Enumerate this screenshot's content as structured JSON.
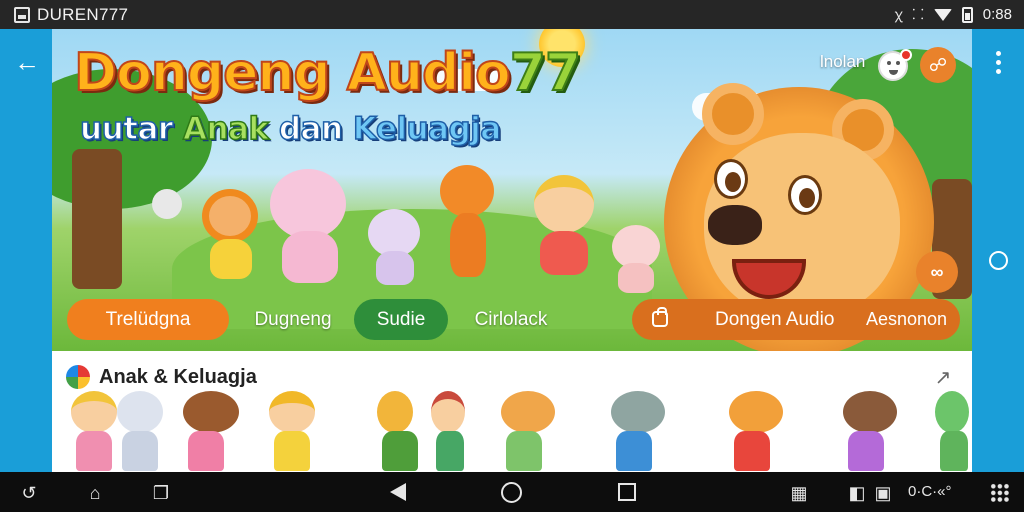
{
  "statusbar": {
    "app_name": "DUREN777",
    "right_glyph_1": "ꭓ",
    "right_glyph_2": "⸬",
    "clock": "0:88"
  },
  "hero": {
    "title_main": "Dongeng Audio",
    "title_accent": "77",
    "subtitle_prefix": "uutar ",
    "subtitle_green": "Anak",
    "subtitle_mid": " dan ",
    "subtitle_blue": "Keluagja",
    "login_label": "lnolan",
    "lock_icon": "lock-icon",
    "link_icon": "link-icon"
  },
  "tabs": [
    {
      "label": "Trelüdgna"
    },
    {
      "label": "Dugneng"
    },
    {
      "label": "Sudie"
    },
    {
      "label": "Cirlolack"
    }
  ],
  "audio_pill": {
    "label": "Dongen Audio",
    "label_2": "Aesnonon"
  },
  "section": {
    "title": "Anak & Keluagja",
    "arrow_icon": "expand-arrow-icon"
  },
  "navbar": {
    "status_text": "0·C·«°"
  },
  "colors": {
    "accent_blue": "#1a9ed8",
    "accent_orange": "#f07f1e",
    "accent_green": "#2e8e3a",
    "title_yellow": "#ffb21b"
  }
}
